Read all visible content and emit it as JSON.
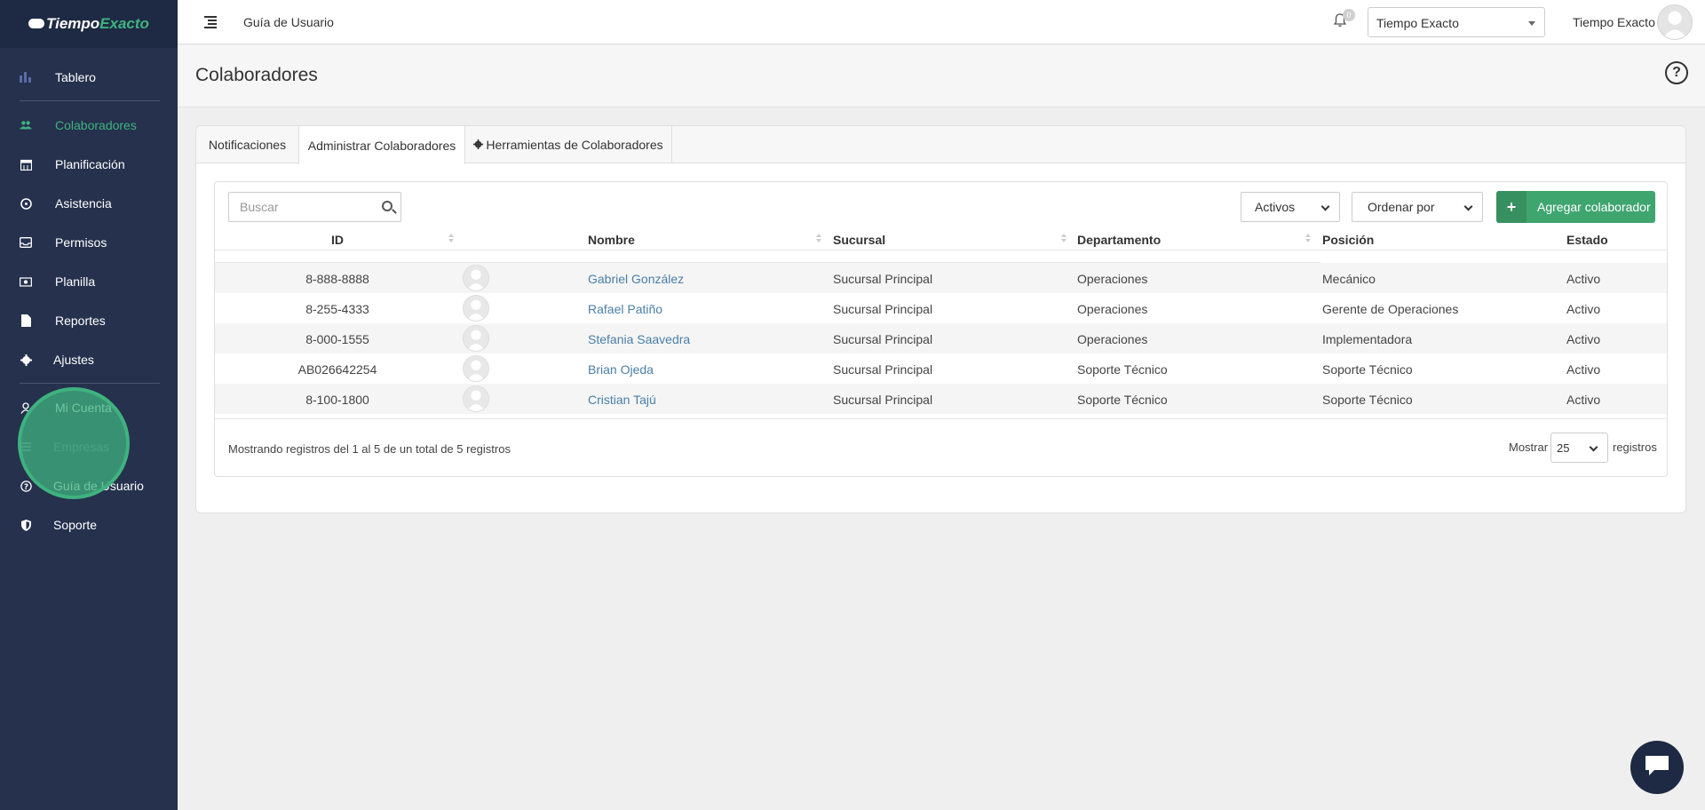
{
  "brand": {
    "name_part1": "Tiempo",
    "name_part2": "Exacto",
    "accent_color": "#3fb27f",
    "sidebar_color": "#25314d"
  },
  "sidebar": {
    "items": [
      {
        "label": "Tablero",
        "icon": "bar-chart-icon"
      },
      {
        "label": "Colaboradores",
        "icon": "users-icon",
        "active": true
      },
      {
        "label": "Planificación",
        "icon": "calendar-icon"
      },
      {
        "label": "Asistencia",
        "icon": "clock-icon"
      },
      {
        "label": "Permisos",
        "icon": "inbox-icon"
      },
      {
        "label": "Planilla",
        "icon": "money-icon"
      },
      {
        "label": "Reportes",
        "icon": "file-icon"
      },
      {
        "label": "Ajustes",
        "icon": "gear-icon"
      },
      {
        "label": "Mi Cuenta",
        "icon": "user-icon"
      },
      {
        "label": "Empresas",
        "icon": "list-icon"
      },
      {
        "label": "Guía de Usuario",
        "icon": "question-circle-icon"
      },
      {
        "label": "Soporte",
        "icon": "shield-icon"
      }
    ]
  },
  "topbar": {
    "link": "Guía de Usuario",
    "notification_count": "0",
    "company_select": "Tiempo Exacto",
    "user_name": "Tiempo Exacto"
  },
  "page": {
    "title": "Colaboradores"
  },
  "tabs": [
    {
      "label": "Notificaciones"
    },
    {
      "label": "Administrar Colaboradores",
      "active": true
    },
    {
      "label": "Herramientas de Colaboradores",
      "icon": "gear-icon"
    }
  ],
  "toolbar": {
    "search_placeholder": "Buscar",
    "status_filter": "Activos",
    "order_by": "Ordenar por",
    "add_button": "Agregar colaborador"
  },
  "table": {
    "columns": [
      "ID",
      "",
      "Nombre",
      "Sucursal",
      "Departamento",
      "Posición",
      "Estado"
    ],
    "rows": [
      {
        "id": "8-888-8888",
        "name": "Gabriel González",
        "branch": "Sucursal Principal",
        "department": "Operaciones",
        "position": "Mecánico",
        "status": "Activo"
      },
      {
        "id": "8-255-4333",
        "name": "Rafael Patiño",
        "branch": "Sucursal Principal",
        "department": "Operaciones",
        "position": "Gerente de Operaciones",
        "status": "Activo"
      },
      {
        "id": "8-000-1555",
        "name": "Stefania Saavedra",
        "branch": "Sucursal Principal",
        "department": "Operaciones",
        "position": "Implementadora",
        "status": "Activo"
      },
      {
        "id": "AB026642254",
        "name": "Brian Ojeda",
        "branch": "Sucursal Principal",
        "department": "Soporte Técnico",
        "position": "Soporte Técnico",
        "status": "Activo"
      },
      {
        "id": "8-100-1800",
        "name": "Cristian Tajú",
        "branch": "Sucursal Principal",
        "department": "Soporte Técnico",
        "position": "Soporte Técnico",
        "status": "Activo"
      }
    ]
  },
  "footer": {
    "info": "Mostrando registros del 1 al 5 de un total de 5 registros",
    "show_label": "Mostrar",
    "page_size": "25",
    "records_label": "registros"
  }
}
